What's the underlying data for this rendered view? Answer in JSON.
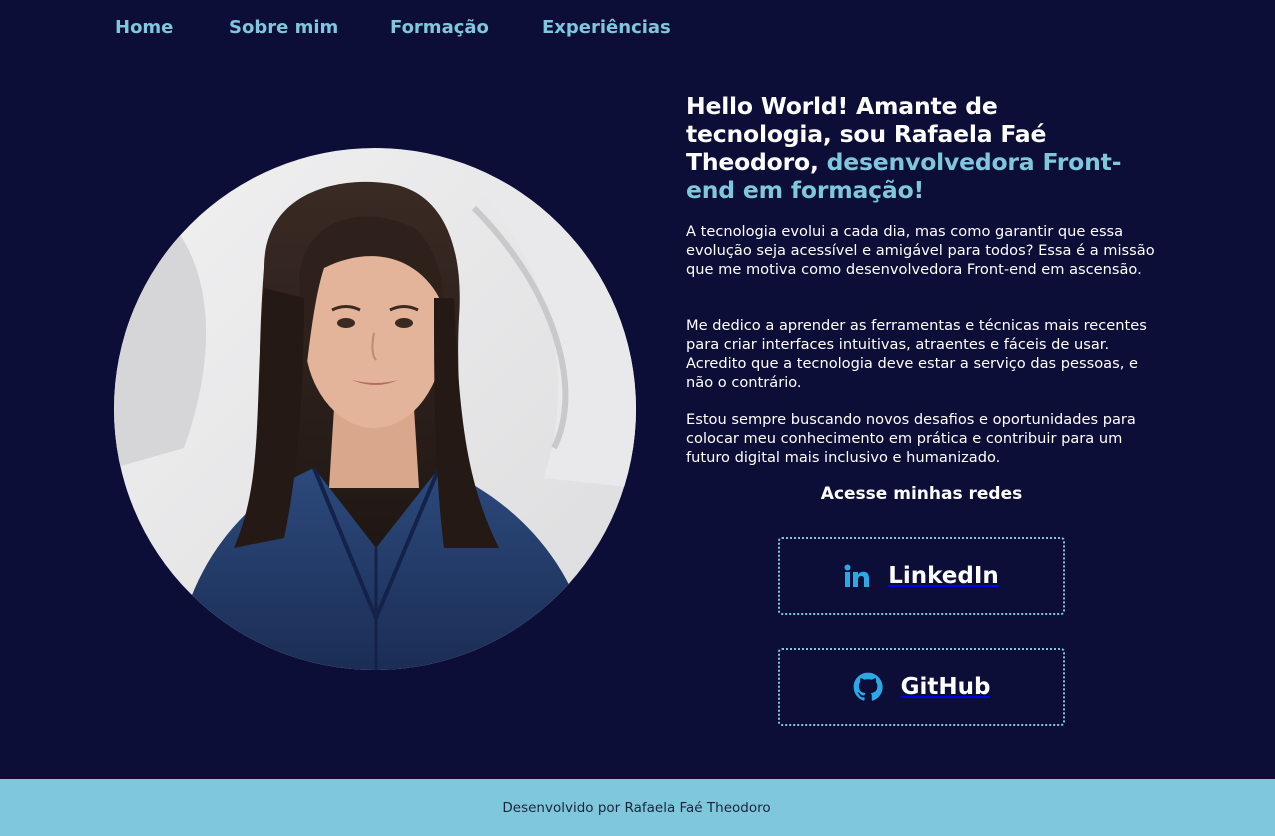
{
  "nav": {
    "items": [
      {
        "label": "Home"
      },
      {
        "label": "Sobre mim"
      },
      {
        "label": "Formação"
      },
      {
        "label": "Experiências"
      }
    ]
  },
  "hero": {
    "headline_part1": "Hello World! Amante de tecnologia, sou Rafaela Faé Theodoro, ",
    "headline_accent": "desenvolvedora Front-end em formação!",
    "paragraphs": [
      "A tecnologia evolui a cada dia, mas como garantir que essa evolução seja acessível e amigável para todos? Essa é a missão que me motiva como desenvolvedora Front-end em ascensão.",
      "Me dedico a aprender as ferramentas e técnicas mais recentes para criar interfaces intuitivas, atraentes e fáceis de usar. Acredito que a tecnologia deve estar a serviço das pessoas, e não o contrário.",
      "Estou sempre buscando novos desafios e oportunidades para colocar meu conhecimento em prática e contribuir para um futuro digital mais inclusivo e humanizado."
    ],
    "redes_title": "Acesse minhas redes",
    "links": [
      {
        "label": "LinkedIn",
        "icon": "linkedin-icon"
      },
      {
        "label": "GitHub",
        "icon": "github-icon"
      }
    ]
  },
  "footer": {
    "text": "Desenvolvido por Rafaela Faé Theodoro"
  },
  "colors": {
    "background": "#0d0e38",
    "accent": "#7ec7dc",
    "footer": "#7fc7db",
    "icon_blue": "#2aa9e6"
  }
}
